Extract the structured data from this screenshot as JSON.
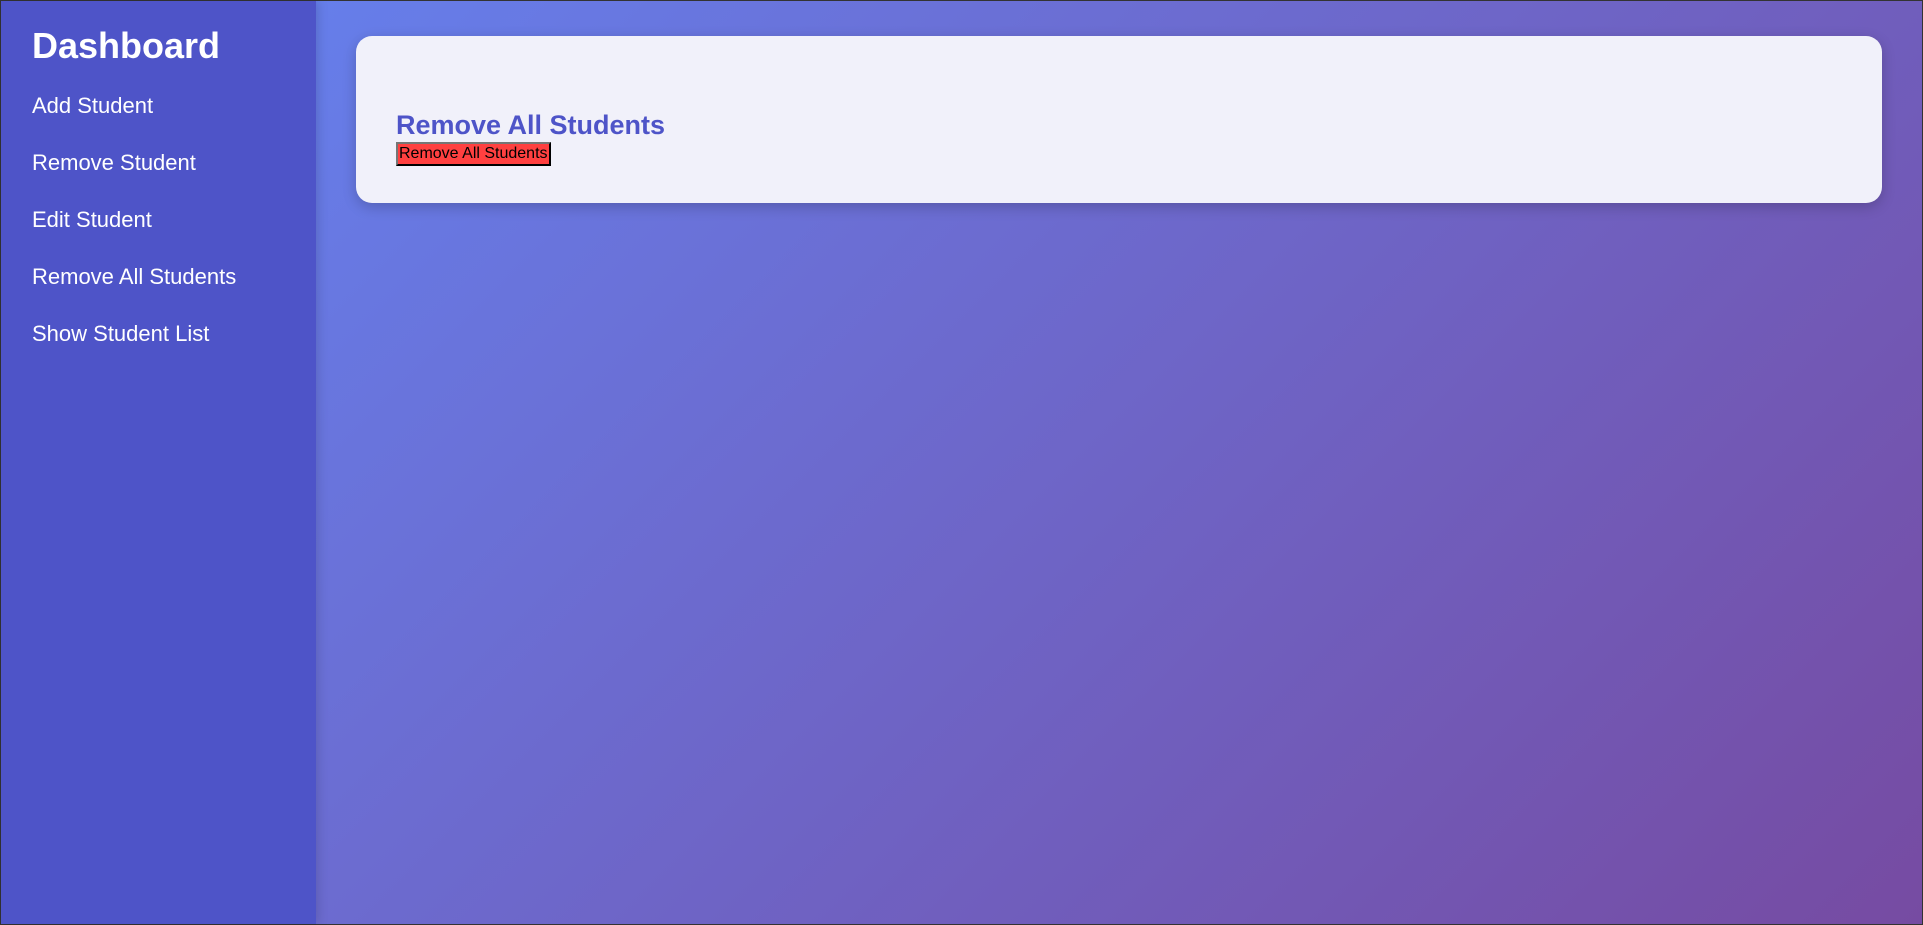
{
  "sidebar": {
    "title": "Dashboard",
    "items": [
      {
        "label": "Add Student"
      },
      {
        "label": "Remove Student"
      },
      {
        "label": "Edit Student"
      },
      {
        "label": "Remove All Students"
      },
      {
        "label": "Show Student List"
      }
    ]
  },
  "main": {
    "card_title": "Remove All Students",
    "button_label": "Remove All Students"
  },
  "colors": {
    "sidebar": "#4e54c8",
    "gradient_start": "#667eea",
    "gradient_end": "#764ba2",
    "danger": "#ff4040"
  }
}
